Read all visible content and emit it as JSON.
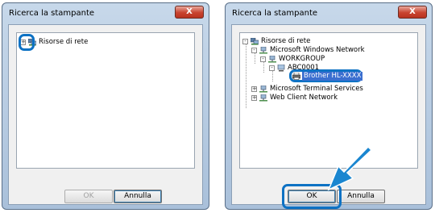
{
  "left_dialog": {
    "title": "Ricerca la stampante",
    "close_label": "X",
    "tree": [
      {
        "label": "Risorse di rete",
        "icon": "network-computer-icon",
        "expander": "+"
      }
    ],
    "ok_label": "OK",
    "cancel_label": "Annulla"
  },
  "right_dialog": {
    "title": "Ricerca la stampante",
    "close_label": "X",
    "tree": [
      {
        "label": "Risorse di rete",
        "icon": "network-computer-icon",
        "expander": "-"
      },
      {
        "label": "Microsoft Windows Network",
        "icon": "network-icon",
        "expander": "-"
      },
      {
        "label": "WORKGROUP",
        "icon": "network-icon",
        "expander": "-"
      },
      {
        "label": "ABC0001",
        "icon": "computer-icon",
        "expander": "-"
      },
      {
        "label": "Brother HL-XXXX",
        "icon": "printer-icon",
        "expander": ""
      },
      {
        "label": "Microsoft Terminal Services",
        "icon": "network-icon",
        "expander": "+"
      },
      {
        "label": "Web Client Network",
        "icon": "network-icon",
        "expander": "+"
      }
    ],
    "ok_label": "OK",
    "cancel_label": "Annulla"
  },
  "colors": {
    "highlight": "#0e72c4",
    "selection": "#3b6fd0",
    "arrow": "#1a86d0"
  }
}
